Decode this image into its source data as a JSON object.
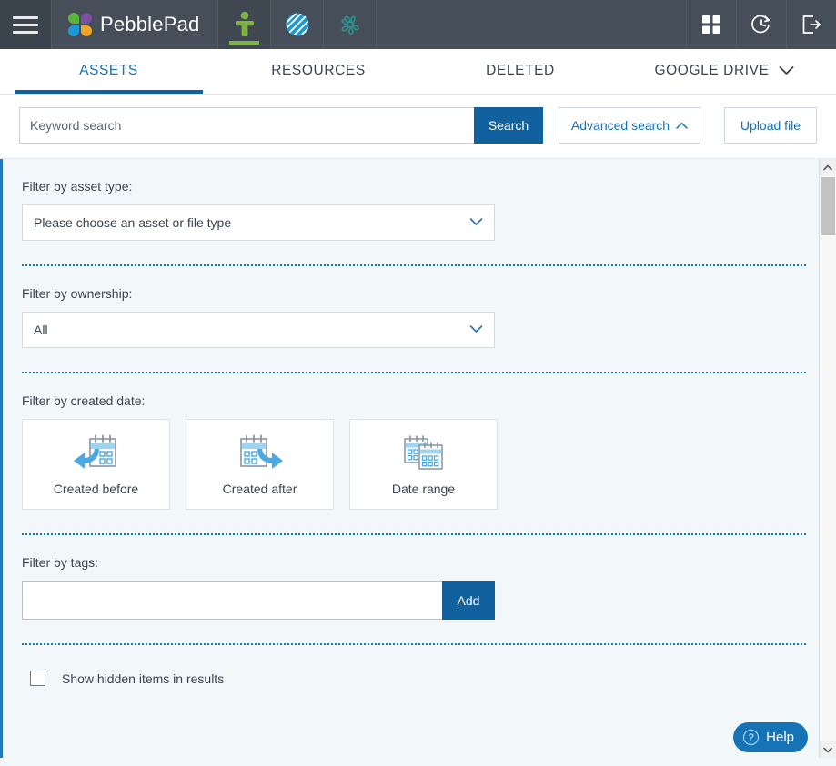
{
  "header": {
    "menu_icon": "hamburger-menu-icon",
    "brand_name": "PebblePad",
    "brand_logo_icon": "pebblepad-flower-logo-icon",
    "app_icons": [
      {
        "name": "pebble-person-icon",
        "active": true
      },
      {
        "name": "striped-circle-icon",
        "active": false
      },
      {
        "name": "teal-flower-icon",
        "active": false
      }
    ],
    "right_icons": [
      {
        "name": "apps-grid-icon"
      },
      {
        "name": "recent-history-clock-icon"
      },
      {
        "name": "logout-icon"
      }
    ]
  },
  "tabs": [
    {
      "label": "ASSETS",
      "active": true
    },
    {
      "label": "RESOURCES",
      "active": false
    },
    {
      "label": "DELETED",
      "active": false
    },
    {
      "label": "GOOGLE DRIVE",
      "active": false,
      "has_chevron": true
    }
  ],
  "search": {
    "placeholder": "Keyword search",
    "value": "",
    "search_label": "Search",
    "advanced_label": "Advanced search",
    "advanced_chevron": "chevron-up-icon",
    "upload_label": "Upload file"
  },
  "filters": {
    "asset_type": {
      "label": "Filter by asset type:",
      "selected": "Please choose an asset or file type"
    },
    "ownership": {
      "label": "Filter by ownership:",
      "selected": "All"
    },
    "created_date": {
      "label": "Filter by created date:",
      "cards": [
        {
          "label": "Created before",
          "icon": "calendar-back-arrow-icon"
        },
        {
          "label": "Created after",
          "icon": "calendar-forward-arrow-icon"
        },
        {
          "label": "Date range",
          "icon": "two-calendars-icon"
        }
      ]
    },
    "tags": {
      "label": "Filter by tags:",
      "value": "",
      "add_label": "Add"
    },
    "hidden_items": {
      "label": "Show hidden items in results",
      "checked": false
    }
  },
  "help": {
    "label": "Help",
    "icon": "question-mark-icon"
  },
  "colors": {
    "header_bg": "#464f59",
    "accent_blue": "#11619e",
    "link_blue": "#1070b8",
    "page_bg": "#f2f8fa",
    "active_green": "#7cb342"
  }
}
